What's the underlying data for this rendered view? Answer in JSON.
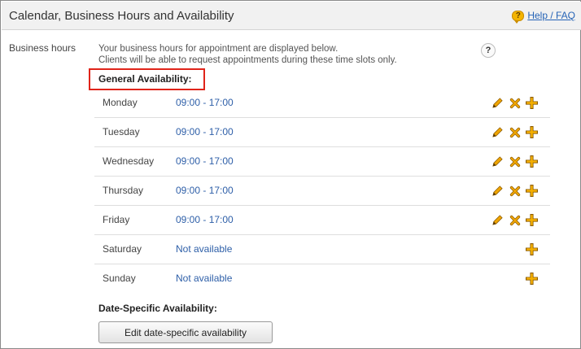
{
  "header": {
    "title": "Calendar, Business Hours and Availability",
    "help_label": "Help / FAQ"
  },
  "business_hours": {
    "label": "Business hours",
    "intro_line1": "Your business hours for appointment are displayed below.",
    "intro_line2": "Clients will be able to request appointments during these time slots only.",
    "info_glyph": "?"
  },
  "general_availability": {
    "heading": "General Availability:",
    "days": [
      {
        "day": "Monday",
        "hours": "09:00 - 17:00",
        "available": true
      },
      {
        "day": "Tuesday",
        "hours": "09:00 - 17:00",
        "available": true
      },
      {
        "day": "Wednesday",
        "hours": "09:00 - 17:00",
        "available": true
      },
      {
        "day": "Thursday",
        "hours": "09:00 - 17:00",
        "available": true
      },
      {
        "day": "Friday",
        "hours": "09:00 - 17:00",
        "available": true
      },
      {
        "day": "Saturday",
        "hours": "Not available",
        "available": false
      },
      {
        "day": "Sunday",
        "hours": "Not available",
        "available": false
      }
    ]
  },
  "date_specific": {
    "heading": "Date-Specific Availability:",
    "button_label": "Edit date-specific availability"
  },
  "icons": {
    "help": "help-bubble-icon",
    "edit": "pencil-icon",
    "delete": "x-icon",
    "add": "plus-icon"
  },
  "colors": {
    "link": "#2563b6",
    "hours_text": "#2e5fa8",
    "highlight_box": "#e0241a",
    "icon_orange": "#f0a500",
    "header_bg": "#f1f1f1"
  }
}
